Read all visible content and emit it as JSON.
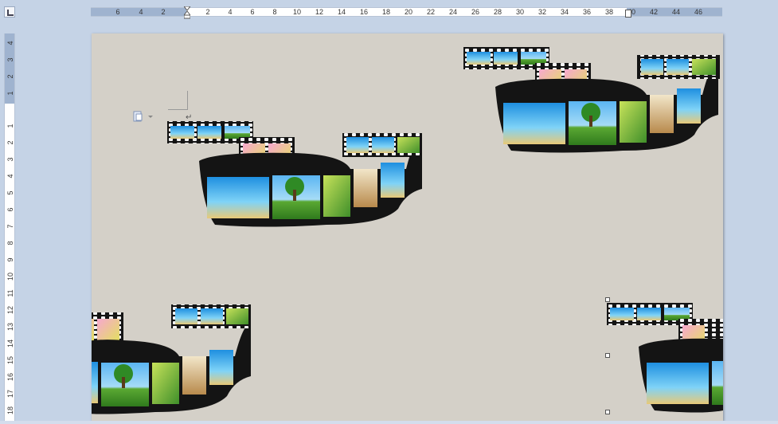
{
  "ruler": {
    "horizontal_ticks": [
      "6",
      "4",
      "2",
      "2",
      "4",
      "6",
      "8",
      "10",
      "12",
      "14",
      "16",
      "18",
      "20",
      "22",
      "24",
      "26",
      "28",
      "30",
      "32",
      "34",
      "36",
      "38",
      "40",
      "42",
      "44",
      "46"
    ],
    "vertical_ticks": [
      "4",
      "3",
      "2",
      "1",
      "1",
      "2",
      "3",
      "4",
      "5",
      "6",
      "7",
      "8",
      "9",
      "10",
      "11",
      "12",
      "13",
      "14",
      "15",
      "16",
      "17",
      "18"
    ]
  },
  "document": {
    "paragraph_mark": "↵",
    "background_color": "#d4d0c8",
    "images": [
      {
        "name": "filmstrip-top-left",
        "description_icon": "filmstrip-image"
      },
      {
        "name": "filmstrip-top-right",
        "description_icon": "filmstrip-image"
      },
      {
        "name": "filmstrip-bottom-left",
        "description_icon": "filmstrip-image"
      },
      {
        "name": "filmstrip-bottom-right",
        "description_icon": "filmstrip-image",
        "selected": true
      }
    ]
  },
  "colors": {
    "ruler_margin": "#9fb3cf",
    "app_background": "#c5d3e6",
    "film_black": "#141414"
  }
}
